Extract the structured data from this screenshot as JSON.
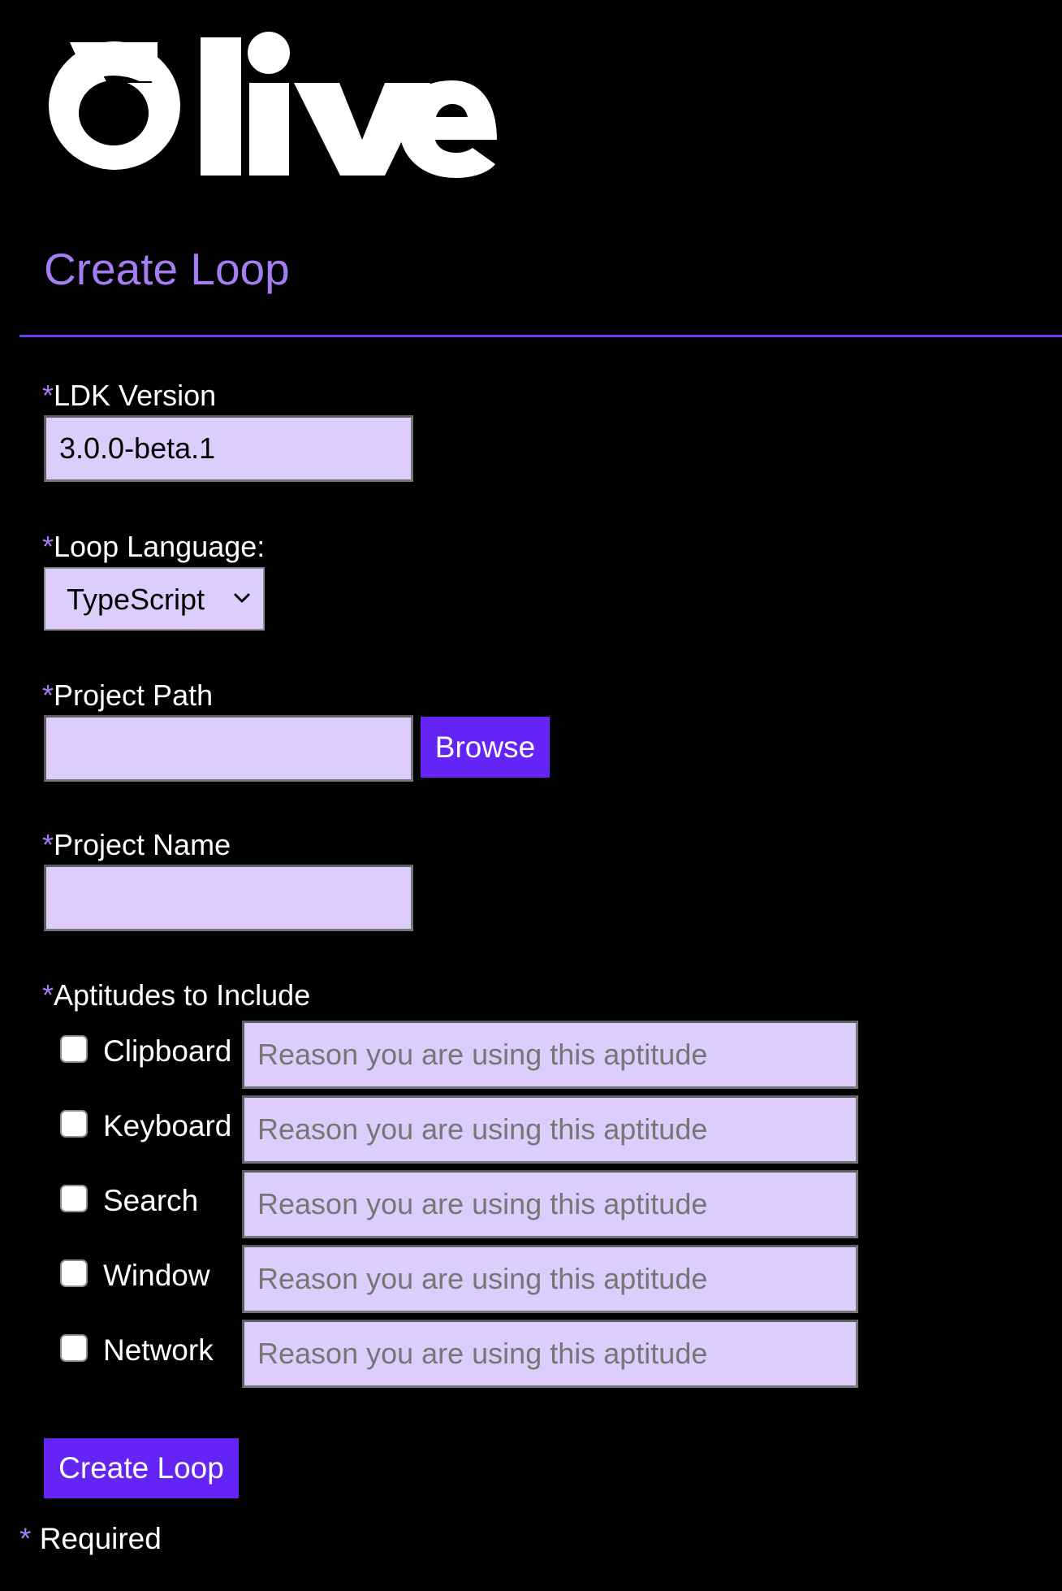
{
  "brand": {
    "logo_text": "Olive"
  },
  "page": {
    "title": "Create Loop"
  },
  "form": {
    "required_marker": "*",
    "ldk_version": {
      "label": "LDK Version",
      "value": "3.0.0-beta.1"
    },
    "loop_language": {
      "label": "Loop Language:",
      "selected": "TypeScript"
    },
    "project_path": {
      "label": "Project Path",
      "value": "",
      "browse_label": "Browse"
    },
    "project_name": {
      "label": "Project Name",
      "value": ""
    },
    "aptitudes": {
      "label": "Aptitudes to Include",
      "placeholder": "Reason you are using this aptitude",
      "items": [
        {
          "name": "Clipboard",
          "checked": false
        },
        {
          "name": "Keyboard",
          "checked": false
        },
        {
          "name": "Search",
          "checked": false
        },
        {
          "name": "Window",
          "checked": false
        },
        {
          "name": "Network",
          "checked": false
        }
      ]
    },
    "submit_label": "Create Loop",
    "required_note": "Required"
  },
  "colors": {
    "background": "#000000",
    "accent_text": "#a67cf3",
    "divider": "#6b3ff2",
    "button": "#6424f5",
    "input_background": "#ddcdfd"
  },
  "icons": {
    "select_chevron": "chevron-down-icon"
  }
}
